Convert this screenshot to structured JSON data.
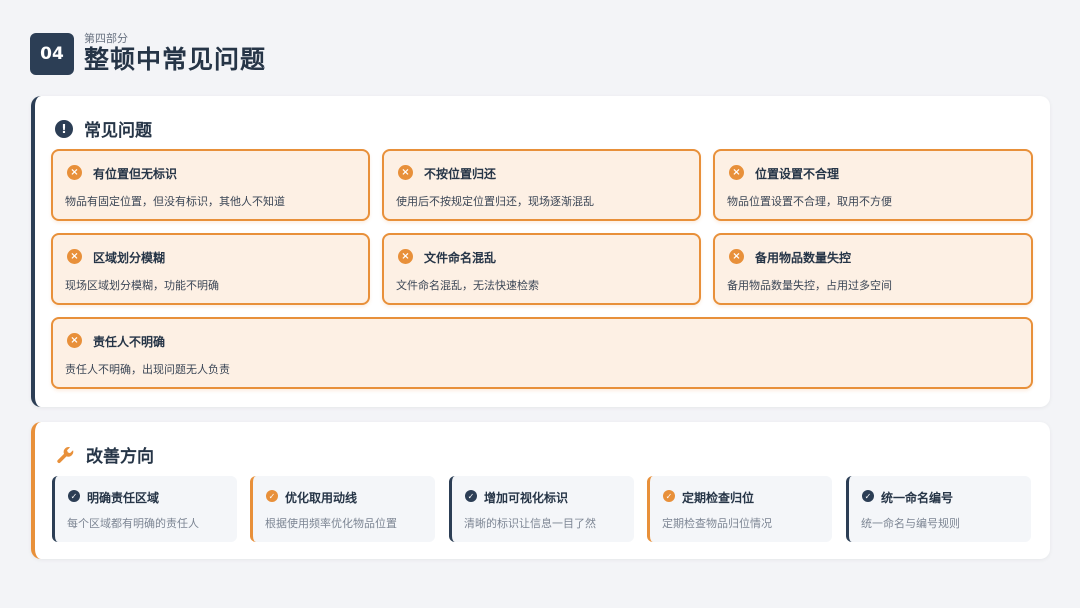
{
  "header": {
    "section_number": "04",
    "subtitle": "第四部分",
    "title": "整顿中常见问题"
  },
  "problems": {
    "heading": "常见问题",
    "icon": "exclamation-icon",
    "cards": [
      {
        "title": "有位置但无标识",
        "desc": "物品有固定位置，但没有标识，其他人不知道"
      },
      {
        "title": "不按位置归还",
        "desc": "使用后不按规定位置归还，现场逐渐混乱"
      },
      {
        "title": "位置设置不合理",
        "desc": "物品位置设置不合理，取用不方便"
      },
      {
        "title": "区域划分模糊",
        "desc": "现场区域划分模糊，功能不明确"
      },
      {
        "title": "文件命名混乱",
        "desc": "文件命名混乱，无法快速检索"
      },
      {
        "title": "备用物品数量失控",
        "desc": "备用物品数量失控，占用过多空间"
      },
      {
        "title": "责任人不明确",
        "desc": "责任人不明确，出现问题无人负责"
      }
    ]
  },
  "improvements": {
    "heading": "改善方向",
    "icon": "wrench-icon",
    "items": [
      {
        "title": "明确责任区域",
        "desc": "每个区域都有明确的责任人",
        "accent": "dark"
      },
      {
        "title": "优化取用动线",
        "desc": "根据使用频率优化物品位置",
        "accent": "orange"
      },
      {
        "title": "增加可视化标识",
        "desc": "清晰的标识让信息一目了然",
        "accent": "dark"
      },
      {
        "title": "定期检查归位",
        "desc": "定期检查物品归位情况",
        "accent": "orange"
      },
      {
        "title": "统一命名编号",
        "desc": "统一命名与编号规则",
        "accent": "dark"
      }
    ]
  },
  "colors": {
    "dark": "#2c3e55",
    "accent": "#e8903a",
    "card_bg": "#fdf0e4"
  }
}
